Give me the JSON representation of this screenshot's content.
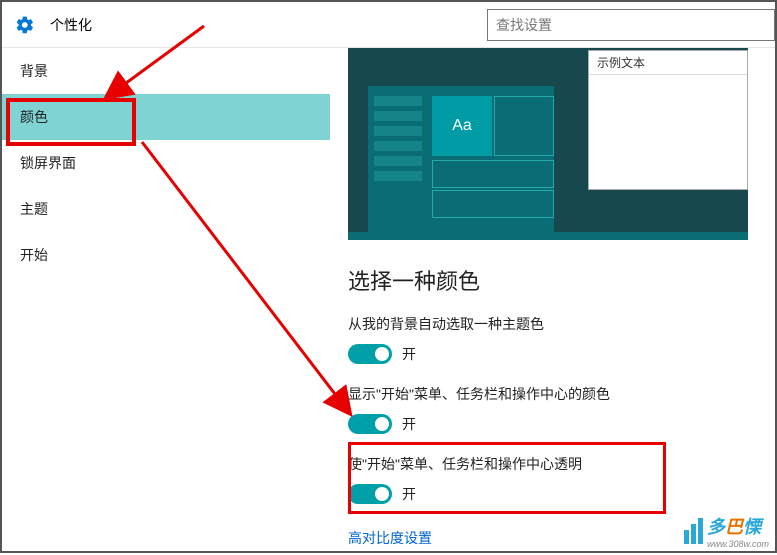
{
  "header": {
    "title": "个性化",
    "search_placeholder": "查找设置"
  },
  "sidebar": {
    "items": [
      {
        "label": "背景"
      },
      {
        "label": "颜色"
      },
      {
        "label": "锁屏界面"
      },
      {
        "label": "主题"
      },
      {
        "label": "开始"
      }
    ],
    "selected_index": 1
  },
  "preview": {
    "sample_text": "示例文本",
    "tile_label": "Aa"
  },
  "content": {
    "section_title": "选择一种颜色",
    "options": [
      {
        "label": "从我的背景自动选取一种主题色",
        "state": "开",
        "on": true
      },
      {
        "label": "显示\"开始\"菜单、任务栏和操作中心的颜色",
        "state": "开",
        "on": true
      },
      {
        "label": "使\"开始\"菜单、任务栏和操作中心透明",
        "state": "开",
        "on": true
      }
    ],
    "link": "高对比度设置"
  },
  "colors": {
    "accent": "#00a0a8",
    "annotation": "#e60000"
  },
  "watermark": {
    "brand1": "多",
    "brand2": "巴",
    "brand3": "慄",
    "url": "www.308w.com"
  }
}
